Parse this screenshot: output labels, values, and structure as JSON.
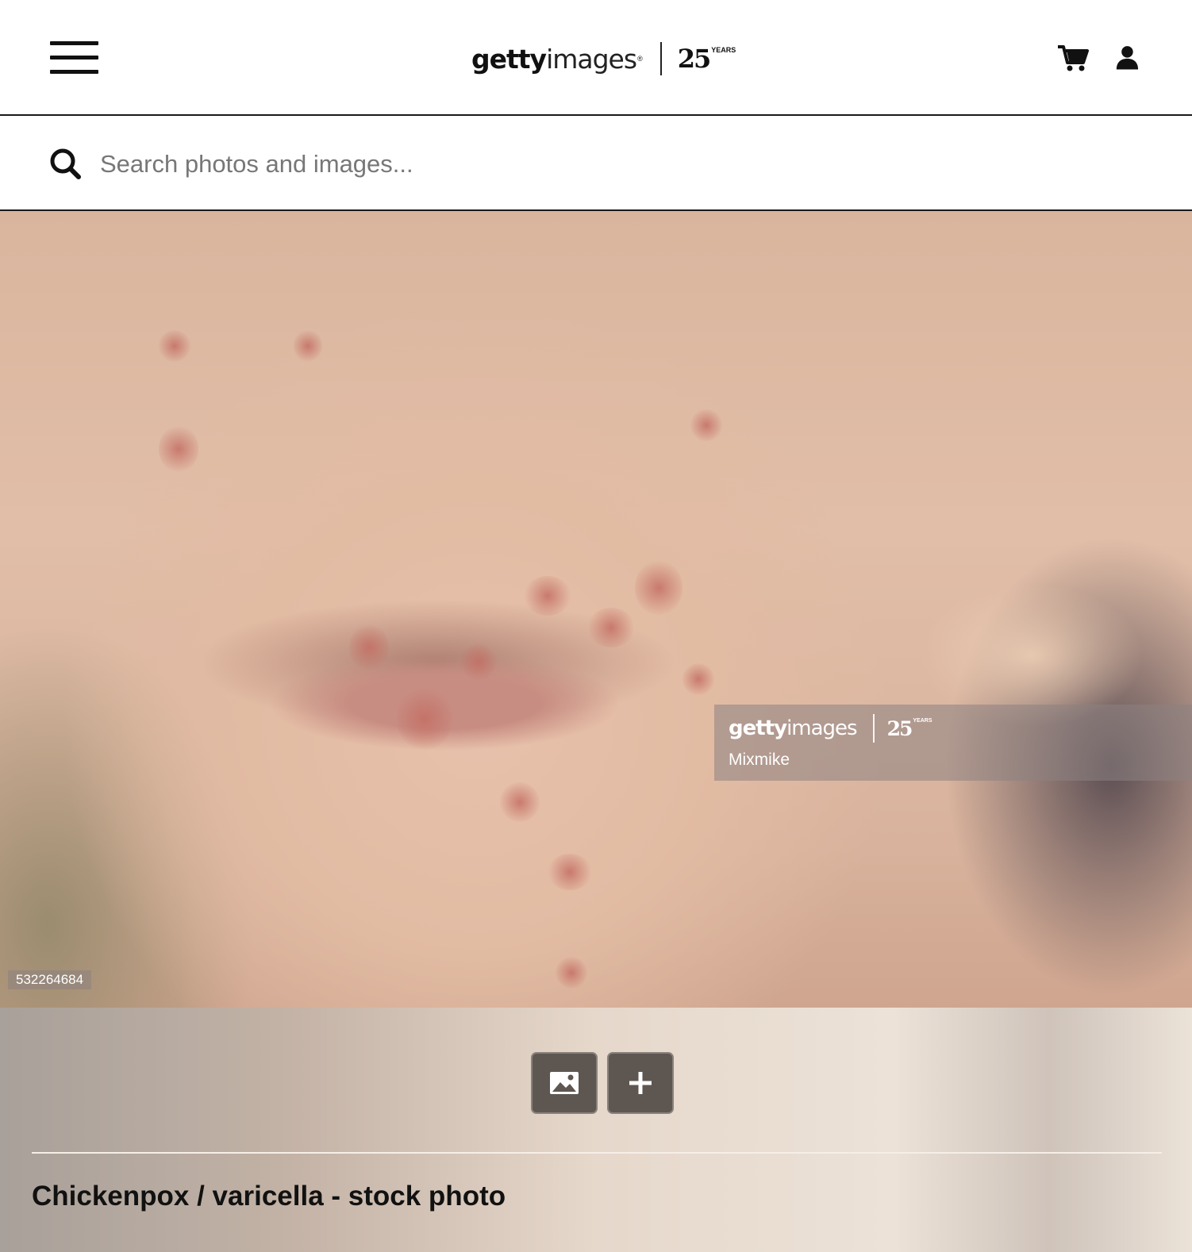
{
  "header": {
    "menu_icon": "hamburger-menu-icon",
    "logo": {
      "getty": "getty",
      "images": "images",
      "anniversary": "25",
      "anniversary_suffix": "YEARS"
    },
    "icons": [
      "cart-icon",
      "user-icon"
    ]
  },
  "search": {
    "placeholder": "Search photos and images...",
    "value": "",
    "icon": "search-icon"
  },
  "photo": {
    "watermark": {
      "getty": "getty",
      "images": "images",
      "anniversary": "25",
      "anniversary_suffix": "YEARS",
      "credit": "Mixmike"
    },
    "image_id": "532264684"
  },
  "actions": {
    "icons": [
      "image-icon",
      "plus-icon"
    ]
  },
  "details": {
    "title": "Chickenpox / varicella - stock photo"
  },
  "colors": {
    "header_bg": "#ffffff",
    "divider": "#1a1a1a",
    "button_bg": "#5e5751"
  }
}
